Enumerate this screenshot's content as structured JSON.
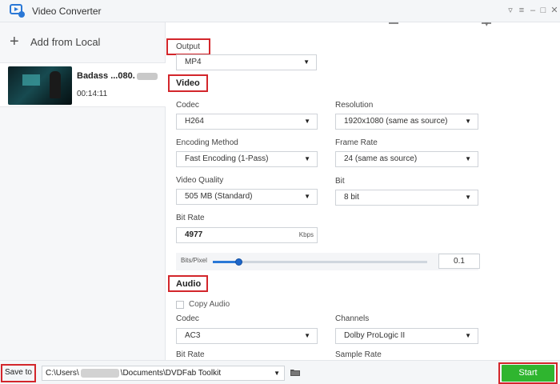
{
  "window": {
    "title": "Video Converter",
    "controls": [
      "pin-icon",
      "menu-icon",
      "minimize-icon",
      "maximize-icon",
      "close-icon"
    ],
    "icon": "video-converter-icon"
  },
  "sidebar": {
    "add_label": "Add from Local",
    "add_icon": "plus-icon",
    "file": {
      "name": "Badass ...080.",
      "duration": "00:14:11"
    }
  },
  "output": {
    "label": "Output",
    "format": "MP4"
  },
  "video": {
    "heading": "Video",
    "codec_label": "Codec",
    "codec": "H264",
    "resolution_label": "Resolution",
    "resolution": "1920x1080 (same as source)",
    "encoding_label": "Encoding Method",
    "encoding": "Fast Encoding (1-Pass)",
    "framerate_label": "Frame Rate",
    "framerate": "24 (same as source)",
    "quality_label": "Video Quality",
    "quality": "505 MB (Standard)",
    "bit_label": "Bit",
    "bit": "8 bit",
    "bitrate_label": "Bit Rate",
    "bitrate": "4977",
    "bitrate_unit": "Kbps",
    "bits_pixel_label": "Bits/Pixel",
    "bits_pixel": "0.1",
    "bits_pixel_level": 0.12
  },
  "audio": {
    "heading": "Audio",
    "copy_label": "Copy Audio",
    "copy_checked": false,
    "codec_label": "Codec",
    "codec": "AC3",
    "channels_label": "Channels",
    "channels": "Dolby ProLogic II",
    "bitrate_label": "Bit Rate",
    "samplerate_label": "Sample Rate"
  },
  "footer": {
    "save_label": "Save to",
    "path_start": "C:\\Users\\",
    "path_end": "\\Documents\\DVDFab Toolkit",
    "start_label": "Start"
  },
  "colors": {
    "accent": "#2a78d6",
    "highlight": "#d3262b",
    "start": "#2fb52f"
  }
}
